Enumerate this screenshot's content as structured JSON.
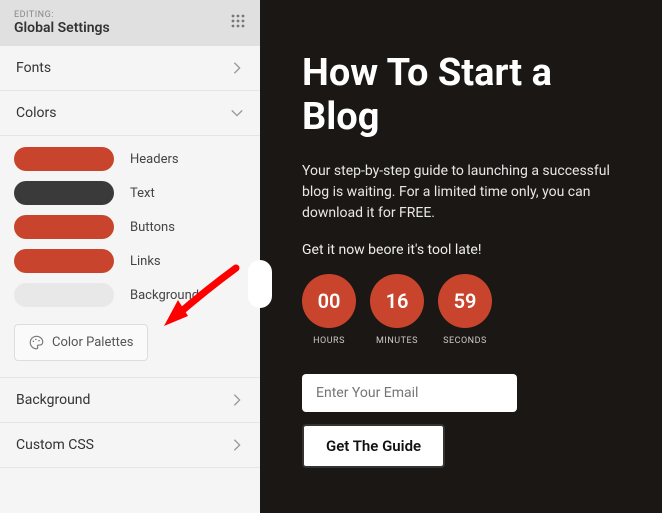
{
  "sidebar": {
    "editing_label": "EDITING:",
    "title": "Global Settings",
    "sections": {
      "fonts": "Fonts",
      "colors": "Colors",
      "background": "Background",
      "custom_css": "Custom CSS"
    },
    "color_items": [
      {
        "label": "Headers",
        "color": "#c9442c"
      },
      {
        "label": "Text",
        "color": "#3a3a3a"
      },
      {
        "label": "Buttons",
        "color": "#c9442c"
      },
      {
        "label": "Links",
        "color": "#c9442c"
      },
      {
        "label": "Background",
        "color": "#e8e8e8"
      }
    ],
    "palettes_btn": "Color Palettes"
  },
  "preview": {
    "heading": "How To Start a Blog",
    "description": "Your step-by-step guide to launching a successful blog is waiting. For a limited time only, you can download it for FREE.",
    "urgency": "Get it now beore it's tool late!",
    "countdown": [
      {
        "value": "00",
        "label": "HOURS"
      },
      {
        "value": "16",
        "label": "MINUTES"
      },
      {
        "value": "59",
        "label": "SECONDS"
      }
    ],
    "email_placeholder": "Enter Your Email",
    "cta": "Get The Guide"
  }
}
